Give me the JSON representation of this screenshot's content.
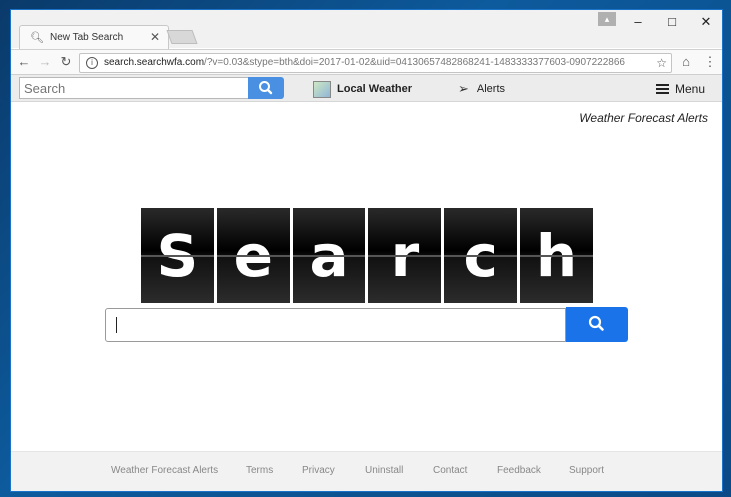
{
  "browser": {
    "tab_title": "New Tab Search",
    "url_host": "search.searchwfa.com",
    "url_rest": "/?v=0.03&stype=bth&doi=2017-01-02&uid=04130657482868241-1483333377603-0907222866"
  },
  "toolbar": {
    "search_placeholder": "Search",
    "local_weather_label": "Local Weather",
    "alerts_label": "Alerts",
    "menu_label": "Menu"
  },
  "page": {
    "brand_link": "Weather Forecast Alerts",
    "logo_letters": [
      "S",
      "e",
      "a",
      "r",
      "c",
      "h"
    ],
    "search_value": ""
  },
  "footer": {
    "links": [
      "Weather Forecast Alerts",
      "Terms",
      "Privacy",
      "Uninstall",
      "Contact",
      "Feedback",
      "Support"
    ]
  },
  "colors": {
    "search_button": "#1a73e8",
    "toolbar_search_button": "#4a90e2"
  }
}
